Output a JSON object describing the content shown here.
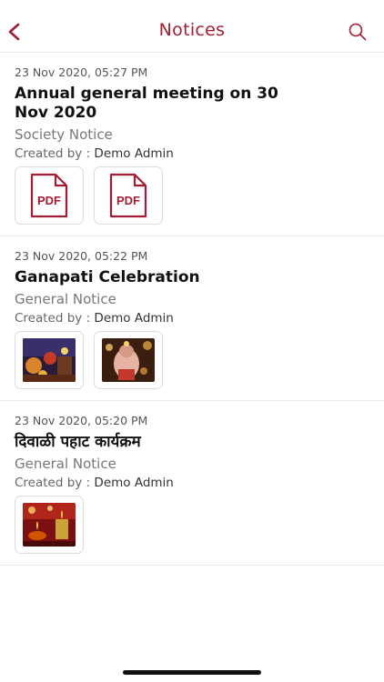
{
  "header": {
    "title": "Notices",
    "accent_color": "#a11d33",
    "back_icon": "chevron-left-icon",
    "search_icon": "search-icon"
  },
  "notices": [
    {
      "timestamp": "23 Nov 2020, 05:27 PM",
      "title": "Annual general meeting on 30 Nov 2020",
      "type": "Society Notice",
      "created_label": "Created by :",
      "creator": "Demo  Admin",
      "attachments": [
        {
          "kind": "pdf",
          "label": "PDF"
        },
        {
          "kind": "pdf",
          "label": "PDF"
        }
      ]
    },
    {
      "timestamp": "23 Nov 2020, 05:22 PM",
      "title": "Ganapati Celebration",
      "type": "General Notice",
      "created_label": "Created by :",
      "creator": "Demo  Admin",
      "attachments": [
        {
          "kind": "image",
          "label": "festival photo"
        },
        {
          "kind": "image",
          "label": "ganpati idol photo"
        }
      ]
    },
    {
      "timestamp": "23 Nov 2020, 05:20 PM",
      "title": "दिवाळी पहाट कार्यक्रम",
      "type": "General Notice",
      "created_label": "Created by :",
      "creator": "Demo  Admin",
      "attachments": [
        {
          "kind": "image",
          "label": "diwali lamps photo"
        }
      ]
    }
  ]
}
